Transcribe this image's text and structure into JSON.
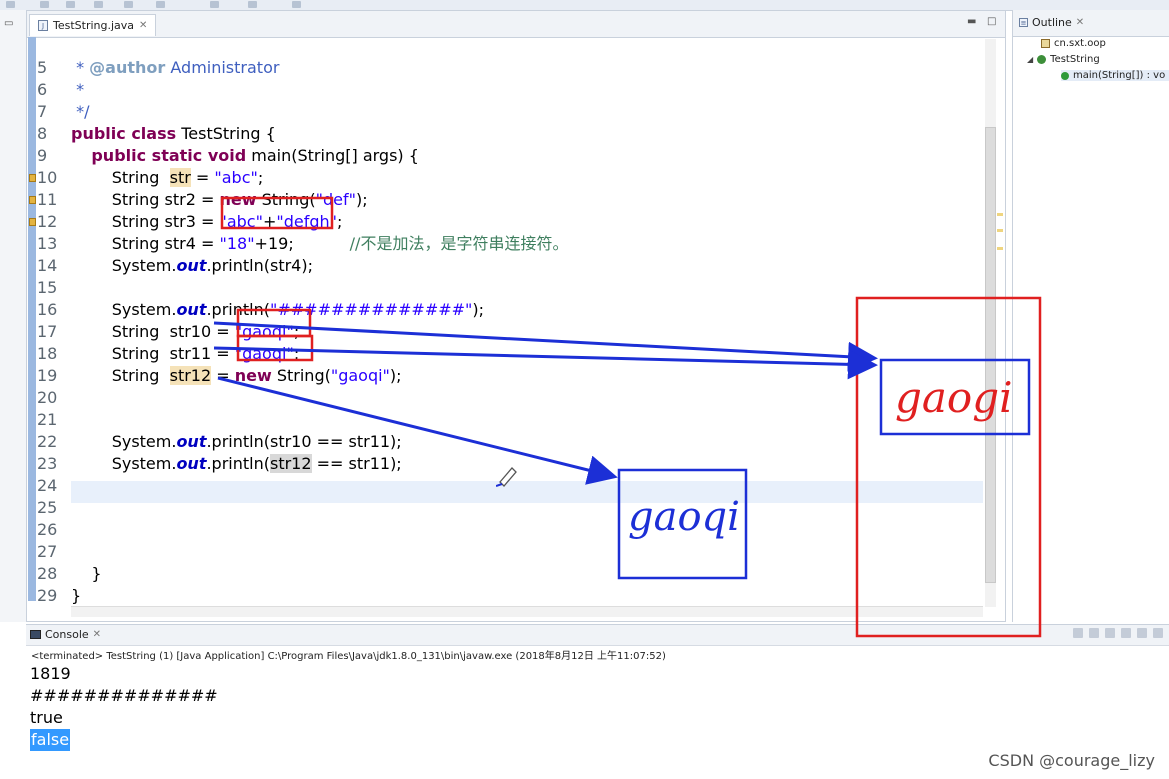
{
  "editor": {
    "tab_label": "TestString.java",
    "lines": [
      {
        "num": "5",
        "segs": [
          {
            "t": " * ",
            "c": "cm"
          },
          {
            "t": "@author",
            "c": "tag"
          },
          {
            "t": " Administrator",
            "c": "cm"
          }
        ]
      },
      {
        "num": "6",
        "segs": [
          {
            "t": " *",
            "c": "cm"
          }
        ]
      },
      {
        "num": "7",
        "segs": [
          {
            "t": " */",
            "c": "cm"
          }
        ]
      },
      {
        "num": "8",
        "segs": [
          {
            "t": "public class",
            "c": "kw"
          },
          {
            "t": " TestString {",
            "c": ""
          }
        ]
      },
      {
        "num": "9",
        "segs": [
          {
            "t": "    ",
            "c": ""
          },
          {
            "t": "public static void",
            "c": "kw"
          },
          {
            "t": " main(String[] args) {",
            "c": ""
          }
        ]
      },
      {
        "num": "10",
        "warn": true,
        "segs": [
          {
            "t": "        String  ",
            "c": ""
          },
          {
            "t": "str",
            "c": "hl-var"
          },
          {
            "t": " = ",
            "c": ""
          },
          {
            "t": "\"abc\"",
            "c": "str"
          },
          {
            "t": ";",
            "c": ""
          }
        ]
      },
      {
        "num": "11",
        "warn": true,
        "segs": [
          {
            "t": "        String ",
            "c": ""
          },
          {
            "t": "str2",
            "c": ""
          },
          {
            "t": " = ",
            "c": ""
          },
          {
            "t": "new",
            "c": "kw"
          },
          {
            "t": " String(",
            "c": ""
          },
          {
            "t": "\"def\"",
            "c": "str"
          },
          {
            "t": ");",
            "c": ""
          }
        ]
      },
      {
        "num": "12",
        "warn": true,
        "segs": [
          {
            "t": "        String ",
            "c": ""
          },
          {
            "t": "str3",
            "c": ""
          },
          {
            "t": " = ",
            "c": ""
          },
          {
            "t": "\"abc\"",
            "c": "str"
          },
          {
            "t": "+",
            "c": ""
          },
          {
            "t": "\"defgh\"",
            "c": "str"
          },
          {
            "t": ";",
            "c": ""
          }
        ]
      },
      {
        "num": "13",
        "segs": [
          {
            "t": "        String str4 = ",
            "c": ""
          },
          {
            "t": "\"18\"",
            "c": "str"
          },
          {
            "t": "+19;           ",
            "c": ""
          },
          {
            "t": "//不是加法，是字符串连接符。",
            "c": "cmt"
          }
        ]
      },
      {
        "num": "14",
        "segs": [
          {
            "t": "        System.",
            "c": ""
          },
          {
            "t": "out",
            "c": "fld"
          },
          {
            "t": ".println(str4);",
            "c": ""
          }
        ]
      },
      {
        "num": "15",
        "segs": []
      },
      {
        "num": "16",
        "segs": [
          {
            "t": "        System.",
            "c": ""
          },
          {
            "t": "out",
            "c": "fld"
          },
          {
            "t": ".println(",
            "c": ""
          },
          {
            "t": "\"##############\"",
            "c": "str"
          },
          {
            "t": ");",
            "c": ""
          }
        ]
      },
      {
        "num": "17",
        "segs": [
          {
            "t": "        String  str10 = ",
            "c": ""
          },
          {
            "t": "\"gaoqi\"",
            "c": "str"
          },
          {
            "t": ";",
            "c": ""
          }
        ]
      },
      {
        "num": "18",
        "segs": [
          {
            "t": "        String  str11 = ",
            "c": ""
          },
          {
            "t": "\"gaoqi\"",
            "c": "str"
          },
          {
            "t": ";",
            "c": ""
          }
        ]
      },
      {
        "num": "19",
        "segs": [
          {
            "t": "        String  ",
            "c": ""
          },
          {
            "t": "str12",
            "c": "hl-var"
          },
          {
            "t": " = ",
            "c": ""
          },
          {
            "t": "new",
            "c": "kw"
          },
          {
            "t": " String(",
            "c": ""
          },
          {
            "t": "\"gaoqi\"",
            "c": "str"
          },
          {
            "t": ");",
            "c": ""
          }
        ]
      },
      {
        "num": "20",
        "segs": []
      },
      {
        "num": "21",
        "segs": []
      },
      {
        "num": "22",
        "segs": [
          {
            "t": "        System.",
            "c": ""
          },
          {
            "t": "out",
            "c": "fld"
          },
          {
            "t": ".println(str10 == str11);",
            "c": ""
          }
        ]
      },
      {
        "num": "23",
        "segs": [
          {
            "t": "        System.",
            "c": ""
          },
          {
            "t": "out",
            "c": "fld"
          },
          {
            "t": ".println(",
            "c": ""
          },
          {
            "t": "str12",
            "c": "hl-occ"
          },
          {
            "t": " == str11);",
            "c": ""
          }
        ]
      },
      {
        "num": "24",
        "segs": []
      },
      {
        "num": "25",
        "segs": []
      },
      {
        "num": "26",
        "segs": []
      },
      {
        "num": "27",
        "segs": []
      },
      {
        "num": "28",
        "segs": [
          {
            "t": "    }",
            "c": ""
          }
        ]
      },
      {
        "num": "29",
        "segs": [
          {
            "t": "}",
            "c": ""
          }
        ]
      }
    ]
  },
  "outline": {
    "tab_label": "Outline",
    "package": "cn.sxt.oop",
    "class_name": "TestString",
    "method": "main(String[]) : vo"
  },
  "console": {
    "tab_label": "Console",
    "status": "<terminated> TestString (1) [Java Application] C:\\Program Files\\Java\\jdk1.8.0_131\\bin\\javaw.exe (2018年8月12日 上午11:07:52)",
    "output": [
      "1819",
      "##############",
      "true",
      "false"
    ]
  },
  "annotations": {
    "handwriting_red": "gaogi",
    "handwriting_blue": "gaoqi"
  },
  "watermark": "CSDN @courage_lizy",
  "colors": {
    "annotation_red": "#e02020",
    "annotation_blue": "#1c2fd6",
    "keyword": "#7f0055",
    "string": "#2a00ff"
  }
}
